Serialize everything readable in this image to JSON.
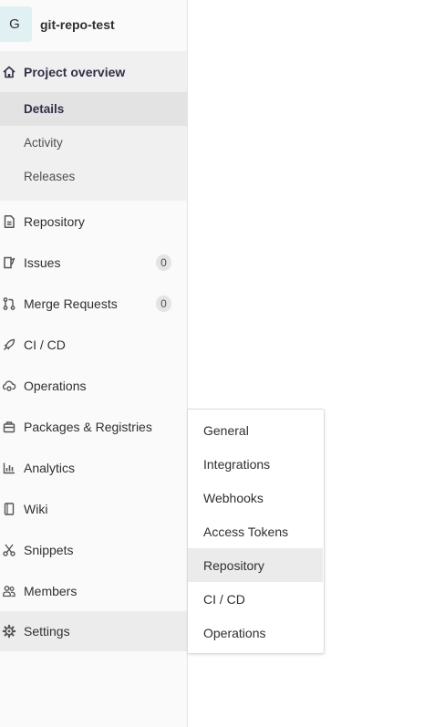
{
  "project": {
    "avatar_letter": "G",
    "name": "git-repo-test"
  },
  "sidebar": {
    "overview": {
      "label": "Project overview",
      "icon": "home-icon",
      "subitems": [
        {
          "label": "Details",
          "active": true
        },
        {
          "label": "Activity"
        },
        {
          "label": "Releases"
        }
      ]
    },
    "items": [
      {
        "label": "Repository",
        "icon": "document-icon"
      },
      {
        "label": "Issues",
        "icon": "issues-icon",
        "badge": "0"
      },
      {
        "label": "Merge Requests",
        "icon": "merge-request-icon",
        "badge": "0"
      },
      {
        "label": "CI / CD",
        "icon": "rocket-icon"
      },
      {
        "label": "Operations",
        "icon": "cloud-gear-icon"
      },
      {
        "label": "Packages & Registries",
        "icon": "package-icon"
      },
      {
        "label": "Analytics",
        "icon": "chart-icon"
      },
      {
        "label": "Wiki",
        "icon": "book-icon"
      },
      {
        "label": "Snippets",
        "icon": "scissors-icon"
      },
      {
        "label": "Members",
        "icon": "users-icon"
      },
      {
        "label": "Settings",
        "icon": "gear-icon"
      }
    ]
  },
  "settings_flyout": {
    "items": [
      {
        "label": "General"
      },
      {
        "label": "Integrations"
      },
      {
        "label": "Webhooks"
      },
      {
        "label": "Access Tokens"
      },
      {
        "label": "Repository",
        "hovered": true
      },
      {
        "label": "CI / CD"
      },
      {
        "label": "Operations"
      }
    ]
  },
  "colors": {
    "sidebar_bg": "#fafafa",
    "active_group_bg": "#f0f0f0",
    "active_item_bg": "#e3e3e3",
    "avatar_bg": "#e1f0f2",
    "active_text": "#303046"
  }
}
